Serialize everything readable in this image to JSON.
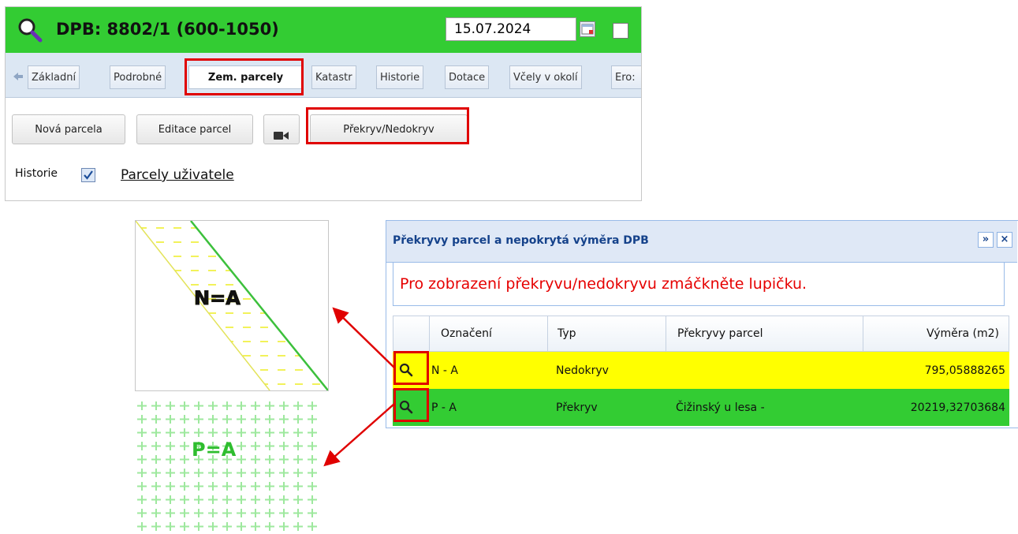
{
  "colors": {
    "header_green": "#33cc33",
    "row_yellow": "#ffff00",
    "row_green": "#33cc33",
    "highlight_red": "#e00000",
    "message_red": "#e60000"
  },
  "header": {
    "title": "DPB: 8802/1 (600-1050)",
    "date": "15.07.2024",
    "icons": [
      "search-icon",
      "calendar-icon"
    ]
  },
  "tabs": [
    {
      "label": "Základní"
    },
    {
      "label": "Podrobné"
    },
    {
      "label": "Zem. parcely",
      "active": true
    },
    {
      "label": "Katastr"
    },
    {
      "label": "Historie"
    },
    {
      "label": "Dotace"
    },
    {
      "label": "Včely v okolí"
    },
    {
      "label": "Ero:"
    }
  ],
  "toolbar": {
    "new_parcel": "Nová parcela",
    "edit_parcels": "Editace parcel",
    "camera_icon": "video-camera-icon",
    "overlap": "Překryv/Nedokryv"
  },
  "options": {
    "history_label": "Historie",
    "history_checked": true,
    "user_parcels_link": "Parcely uživatele"
  },
  "dialog": {
    "title": "Překryvy parcel a nepokrytá výměra DPB",
    "message": "Pro zobrazení překryvu/nedokryvu zmáčkněte lupičku.",
    "columns": [
      "Označení",
      "Typ",
      "Překryvy parcel",
      "Výměra (m2)"
    ],
    "rows": [
      {
        "label": "N - A",
        "type": "Nedokryv",
        "overlaps": "",
        "area": "795,05888265"
      },
      {
        "label": "P - A",
        "type": "Překryv",
        "overlaps": "Čižinský u lesa -",
        "area": "20219,32703684"
      }
    ]
  },
  "thumbnails": {
    "undercover": "N=A",
    "overlap": "P=A"
  }
}
